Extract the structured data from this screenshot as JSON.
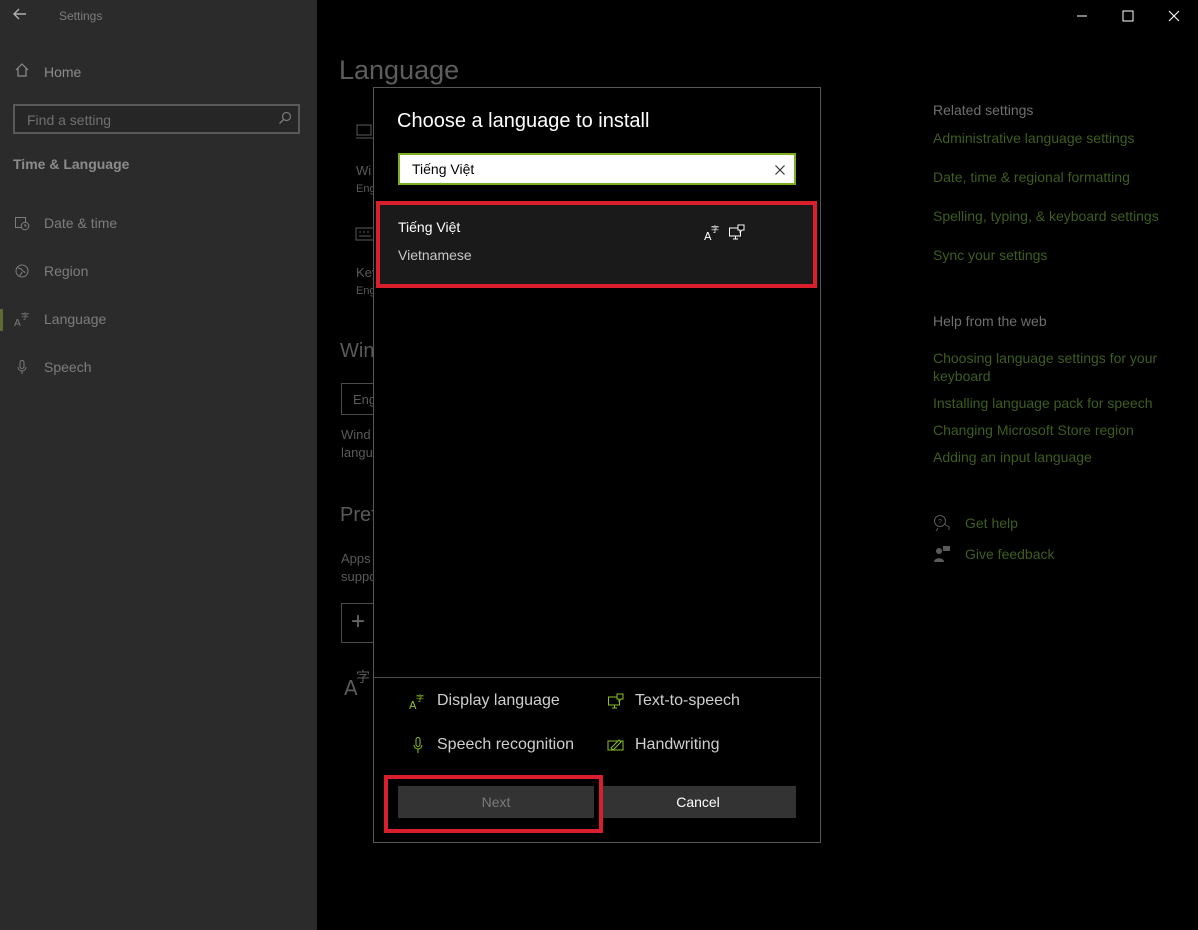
{
  "app": {
    "title": "Settings"
  },
  "sidebar": {
    "home": "Home",
    "search_placeholder": "Find a setting",
    "section": "Time & Language",
    "items": [
      {
        "label": "Date & time",
        "icon": "clock-icon"
      },
      {
        "label": "Region",
        "icon": "globe-icon"
      },
      {
        "label": "Language",
        "icon": "language-icon"
      },
      {
        "label": "Speech",
        "icon": "microphone-icon"
      }
    ]
  },
  "main": {
    "title": "Language",
    "fragments": {
      "wi": "Wi",
      "eng1": "Eng",
      "key": "Key",
      "eng2": "Eng",
      "win": "Win",
      "eng_box": "Eng",
      "wind": "Wind",
      "langu": "langu",
      "pref": "Pref",
      "apps": "Apps",
      "suppo": "suppo"
    }
  },
  "related": {
    "heading": "Related settings",
    "links": [
      "Administrative language settings",
      "Date, time & regional formatting",
      "Spelling, typing, & keyboard settings",
      "Sync your settings"
    ]
  },
  "help_web": {
    "heading": "Help from the web",
    "links": [
      "Choosing language settings for your keyboard",
      "Installing language pack for speech",
      "Changing Microsoft Store region",
      "Adding an input language"
    ]
  },
  "help": {
    "get_help": "Get help",
    "give_feedback": "Give feedback"
  },
  "dialog": {
    "title": "Choose a language to install",
    "search_value": "Tiếng Việt",
    "result": {
      "name": "Tiếng Việt",
      "english": "Vietnamese"
    },
    "legend": {
      "display": "Display language",
      "tts": "Text-to-speech",
      "speech": "Speech recognition",
      "handwriting": "Handwriting"
    },
    "next": "Next",
    "cancel": "Cancel"
  },
  "colors": {
    "accent": "#7cae1f",
    "highlight": "#d91f2b",
    "link": "#3f5d1f"
  }
}
